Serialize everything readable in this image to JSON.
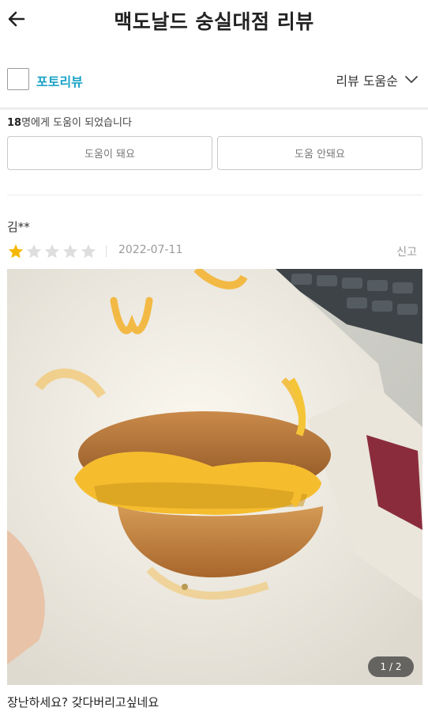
{
  "header": {
    "title": "맥도날드 숭실대점 리뷰",
    "back_icon": "arrow-left-icon"
  },
  "filter": {
    "photo_review_label": "포토리뷰",
    "photo_review_checked": false,
    "sort_label": "리뷰 도움순",
    "sort_icon": "chevron-down-icon",
    "accent_color": "#1aa3c6"
  },
  "helpful": {
    "count": "18",
    "text": "명에게 도움이 되었습니다",
    "yes_label": "도움이 돼요",
    "no_label": "도움 안돼요"
  },
  "review": {
    "author": "김**",
    "rating": 1,
    "max_rating": 5,
    "star_color": "#f5b800",
    "date": "2022-07-11",
    "report_label": "신고",
    "photo_icon": "burger-photo",
    "photo_index": "1 / 2",
    "comment": "장난하세요? 갖다버리고싶네요"
  }
}
